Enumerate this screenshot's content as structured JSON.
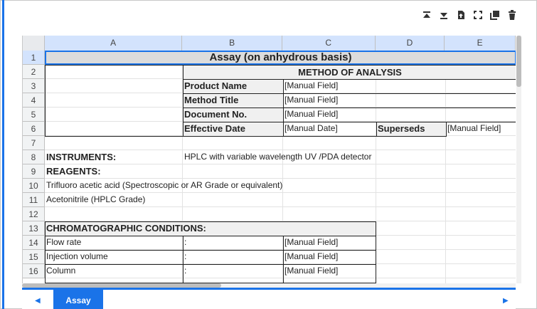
{
  "toolbar": {
    "icons": [
      "move-top-icon",
      "move-bottom-icon",
      "export-file-icon",
      "fullscreen-icon",
      "copy-icon",
      "delete-icon"
    ]
  },
  "columns": [
    "A",
    "B",
    "C",
    "D",
    "E"
  ],
  "rows": [
    "1",
    "2",
    "3",
    "4",
    "5",
    "6",
    "7",
    "8",
    "9",
    "10",
    "11",
    "12",
    "13",
    "14",
    "15",
    "16"
  ],
  "cells": {
    "title": "Assay (on anhydrous basis)",
    "method_header": "METHOD OF ANALYSIS",
    "product_name_label": "Product Name",
    "product_name_value": "[Manual Field]",
    "method_title_label": "Method Title",
    "method_title_value": "[Manual Field]",
    "document_no_label": "Document No.",
    "document_no_value": "[Manual Field]",
    "effective_date_label": "Effective Date",
    "effective_date_value": "[Manual Date]",
    "supersedes_label": "Superseds",
    "supersedes_value": "[Manual Field]",
    "instruments_label": "INSTRUMENTS:",
    "instruments_value": "HPLC with variable wavelength UV /PDA detector",
    "reagents_label": "REAGENTS:",
    "reagent_1": "Trifluoro acetic acid (Spectroscopic or AR Grade or equivalent)",
    "reagent_2": "Acetonitrile (HPLC Grade)",
    "chrom_label": "CHROMATOGRAPHIC CONDITIONS:",
    "flow_rate_label": "Flow rate",
    "flow_rate_sep": ":",
    "flow_rate_value": "[Manual Field]",
    "injection_label": "Injection volume",
    "injection_sep": ":",
    "injection_value": "[Manual Field]",
    "column_label": "Column",
    "column_sep": ":",
    "column_value": "[Manual Field]"
  },
  "tabs": {
    "active": "Assay"
  },
  "colors": {
    "accent": "#1a73e8",
    "header_selected": "#d3e3fd"
  }
}
